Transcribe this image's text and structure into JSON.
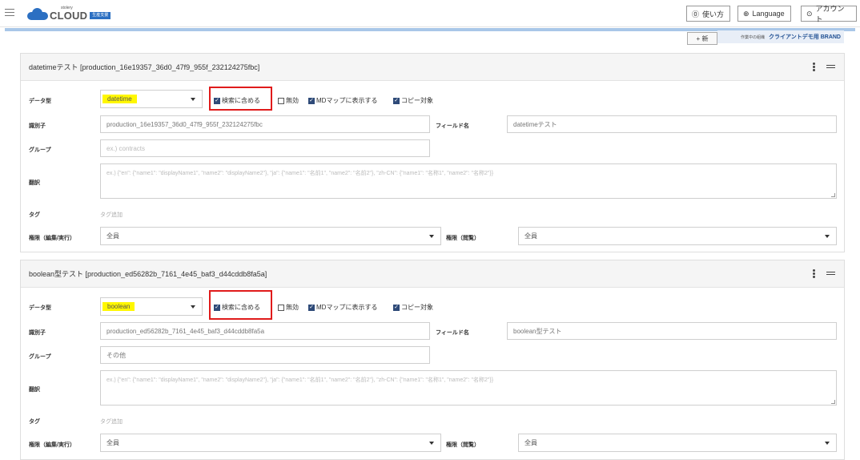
{
  "header": {
    "logo_small": "stolery",
    "logo_word": "CLOUD",
    "logo_badge": "生産支援",
    "help_label": "使い方",
    "language_label": "Language",
    "account_label": "アカウント"
  },
  "toolbar": {
    "new_label": "+ 新",
    "brand_label": "作業中の組織",
    "brand_value": "クライアントデモ用 BRAND"
  },
  "labels": {
    "data_type": "データ型",
    "identifier": "識別子",
    "field_name": "フィールド名",
    "group": "グループ",
    "translation": "翻訳",
    "tag": "タグ",
    "perm_edit": "権限（編集/実行）",
    "perm_view": "権限（閲覧）",
    "tag_add": "タグ追加",
    "chk_search": "検索に含める",
    "chk_disabled": "無効",
    "chk_md": "MDマップに表示する",
    "chk_copy": "コピー対象"
  },
  "cards": [
    {
      "title": "datetimeテスト [production_16e19357_36d0_47f9_955f_232124275fbc]",
      "data_type": "datetime",
      "identifier": "production_16e19357_36d0_47f9_955f_232124275fbc",
      "field_name": "datetimeテスト",
      "group_placeholder": "ex.) contracts",
      "translation_placeholder": "ex.) {\"en\": {\"name1\": \"displayName1\", \"name2\": \"displayName2\"}, \"ja\": {\"name1\": \"名前1\", \"name2\": \"名前2\"}, \"zh-CN\": {\"name1\": \"名称1\", \"name2\": \"名称2\"}}",
      "perm_edit": "全員",
      "perm_view": "全員",
      "checks": {
        "search": true,
        "disabled": false,
        "md": true,
        "copy": true
      }
    },
    {
      "title": "boolean型テスト [production_ed56282b_7161_4e45_baf3_d44cddb8fa5a]",
      "data_type": "boolean",
      "identifier": "production_ed56282b_7161_4e45_baf3_d44cddb8fa5a",
      "field_name": "boolean型テスト",
      "group_value": "その他",
      "translation_placeholder": "ex.) {\"en\": {\"name1\": \"displayName1\", \"name2\": \"displayName2\"}, \"ja\": {\"name1\": \"名前1\", \"name2\": \"名前2\"}, \"zh-CN\": {\"name1\": \"名称1\", \"name2\": \"名称2\"}}",
      "perm_edit": "全員",
      "perm_view": "全員",
      "checks": {
        "search": true,
        "disabled": false,
        "md": true,
        "copy": true
      }
    }
  ],
  "colors": {
    "accent": "#2b6fc2",
    "highlight": "#fff700",
    "annotation_red": "#e01b1b",
    "check_fill": "#2e4a78"
  }
}
